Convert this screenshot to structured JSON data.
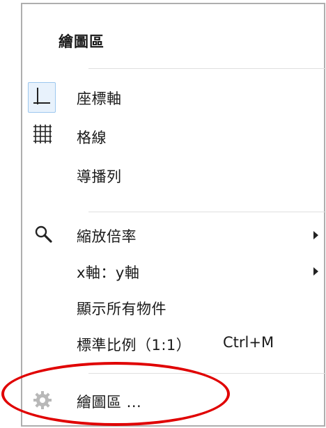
{
  "menu": {
    "title": "繪圖區",
    "items": [
      {
        "label": "座標軸",
        "icon": "axes-icon",
        "selected": true
      },
      {
        "label": "格線",
        "icon": "grid-icon"
      },
      {
        "label": "導播列",
        "icon": ""
      },
      {
        "label": "縮放倍率",
        "icon": "magnifier-icon",
        "submenu": true
      },
      {
        "label": "x軸：y軸",
        "icon": "",
        "submenu": true
      },
      {
        "label": "顯示所有物件",
        "icon": ""
      },
      {
        "label": "標準比例（1:1）",
        "icon": "",
        "shortcut": "Ctrl+M"
      },
      {
        "label": "繪圖區 ...",
        "icon": "gear-icon"
      }
    ]
  },
  "colors": {
    "highlight": "#e00000",
    "selected_bg": "#e8f2fc",
    "border": "#aeaeae"
  }
}
